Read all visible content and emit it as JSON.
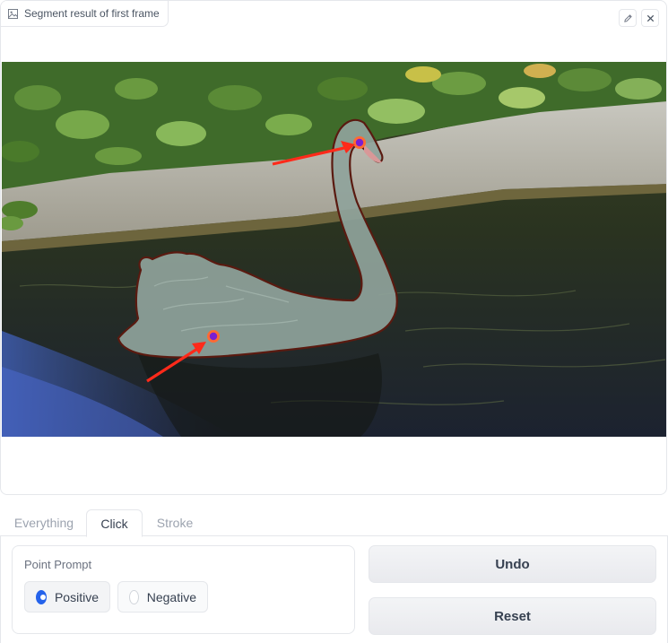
{
  "image_panel": {
    "label": "Segment result of first frame",
    "label_icon": "image-icon",
    "edit_icon": "pencil-icon",
    "close_icon": "close-icon"
  },
  "tabs": [
    {
      "label": "Everything",
      "active": false
    },
    {
      "label": "Click",
      "active": true
    },
    {
      "label": "Stroke",
      "active": false
    }
  ],
  "point_prompt": {
    "title": "Point Prompt",
    "options": [
      {
        "label": "Positive",
        "selected": true
      },
      {
        "label": "Negative",
        "selected": false
      }
    ]
  },
  "buttons": {
    "undo": "Undo",
    "reset": "Reset"
  },
  "colors": {
    "accent": "#2563eb",
    "mask_fill": "#8fa39b",
    "mask_outline": "#5a1a10",
    "click_point": "#7b1fd1",
    "click_ring": "#ff6a33",
    "arrow": "#ff2a1a"
  }
}
